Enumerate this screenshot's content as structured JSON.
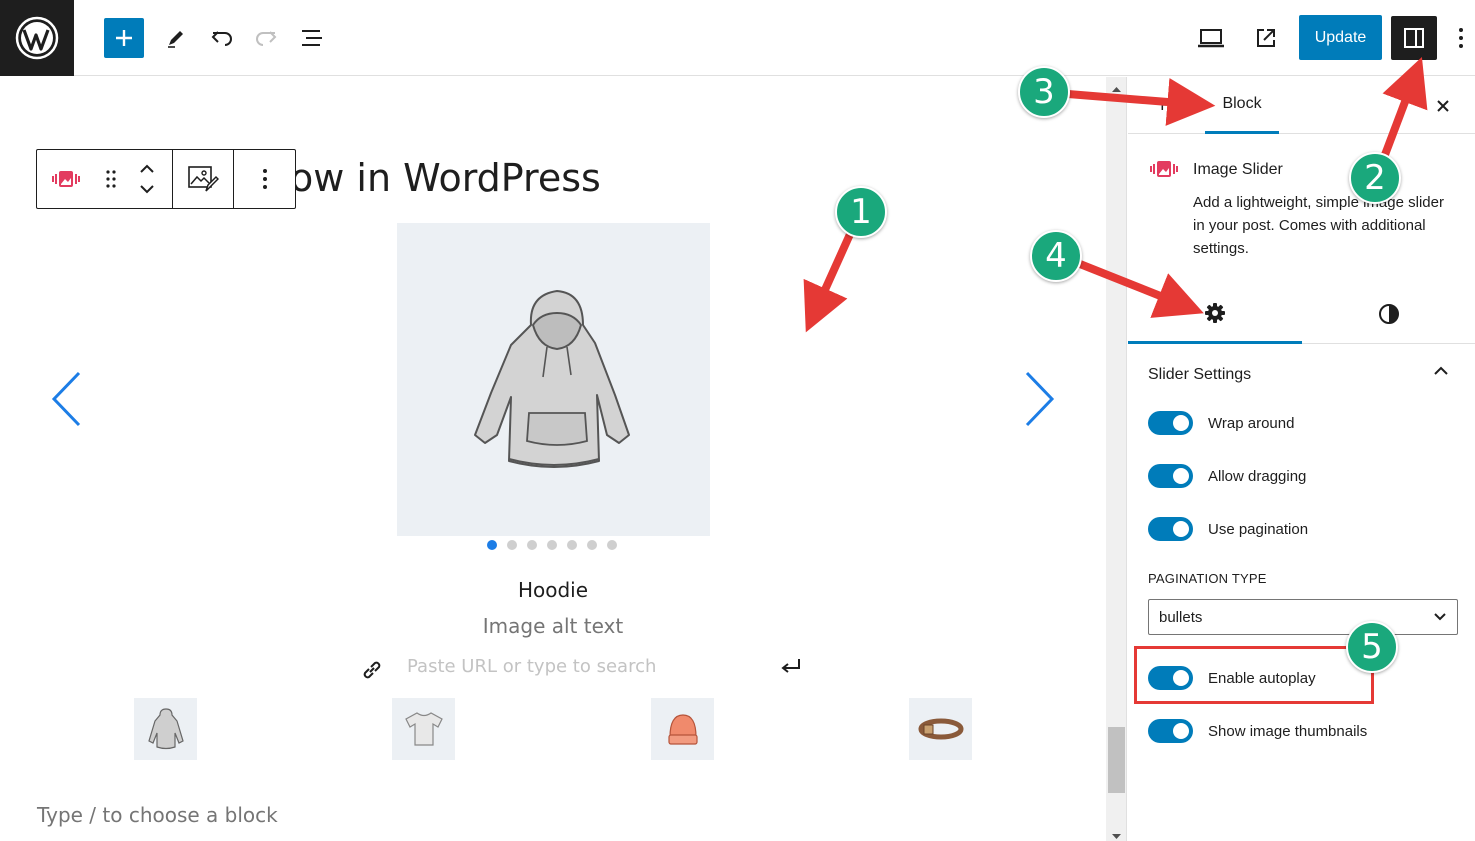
{
  "topbar": {
    "update_label": "Update"
  },
  "editor": {
    "post_title": "ow in WordPress",
    "slide_caption": "Hoodie",
    "slide_alt": "Image alt text",
    "url_placeholder": "Paste URL or type to search",
    "appender_text": "Type / to choose a block",
    "pagination_dots": 7,
    "active_dot": 0
  },
  "sidebar": {
    "tabs": {
      "post": "Po",
      "block": "Block"
    },
    "block_card": {
      "title": "Image Slider",
      "description": "Add a lightweight, simple image slider in your post. Comes with additional settings."
    },
    "panel": {
      "title": "Slider Settings",
      "toggles": [
        {
          "label": "Wrap around",
          "checked": true
        },
        {
          "label": "Allow dragging",
          "checked": true
        },
        {
          "label": "Use pagination",
          "checked": true
        },
        {
          "label": "Enable autoplay",
          "checked": true
        },
        {
          "label": "Show image thumbnails",
          "checked": true
        }
      ],
      "pagination_type_label": "PAGINATION TYPE",
      "pagination_type_value": "bullets"
    }
  },
  "annotations": {
    "badges": [
      "1",
      "2",
      "3",
      "4",
      "5"
    ]
  },
  "colors": {
    "accent": "#007cba",
    "dark": "#1e1e1e",
    "badge": "#1aa87c",
    "arrow": "#e53935",
    "dot_active": "#1c7de6"
  }
}
